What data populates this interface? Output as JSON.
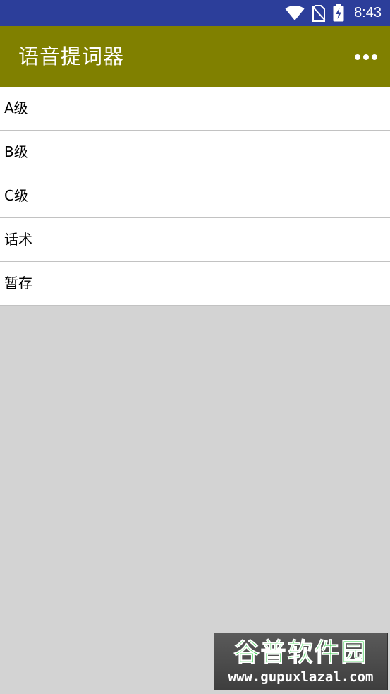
{
  "status_bar": {
    "time": "8:43",
    "icons": [
      "wifi-icon",
      "no-sim-icon",
      "battery-charging-icon"
    ]
  },
  "app_bar": {
    "title": "语音提词器",
    "overflow_icon": "more-horizontal-icon"
  },
  "list": {
    "items": [
      {
        "label": "A级"
      },
      {
        "label": "B级"
      },
      {
        "label": "C级"
      },
      {
        "label": "话术"
      },
      {
        "label": "暂存"
      }
    ]
  },
  "watermark": {
    "brand": "谷普软件园",
    "url": "www.gupuxlazal.com"
  },
  "colors": {
    "status_bar": "#2c3e9a",
    "app_bar": "#808000",
    "background": "#d3d3d3",
    "list_background": "#ffffff",
    "divider": "#c2c2c2",
    "watermark_green": "#32d048"
  }
}
